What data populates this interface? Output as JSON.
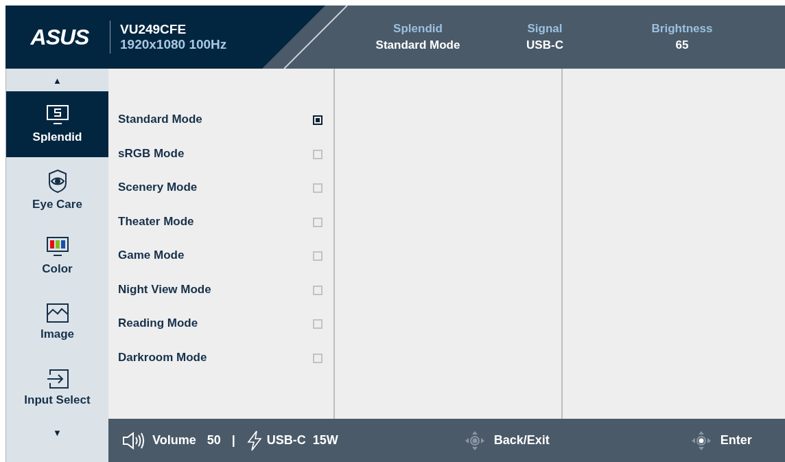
{
  "header": {
    "logo": "ASUS",
    "model": "VU249CFE",
    "resolution": "1920x1080 100Hz",
    "status": [
      {
        "label": "Splendid",
        "value": "Standard Mode"
      },
      {
        "label": "Signal",
        "value": "USB-C"
      },
      {
        "label": "Brightness",
        "value": "65"
      }
    ]
  },
  "sidebar": {
    "up": "▲",
    "down": "▼",
    "items": [
      {
        "kind": "splendid",
        "label": "Splendid",
        "selected": true
      },
      {
        "kind": "eyecare",
        "label": "Eye Care",
        "selected": false
      },
      {
        "kind": "color",
        "label": "Color",
        "selected": false
      },
      {
        "kind": "image",
        "label": "Image",
        "selected": false
      },
      {
        "kind": "input",
        "label": "Input Select",
        "selected": false
      }
    ]
  },
  "options": [
    {
      "label": "Standard Mode",
      "checked": true
    },
    {
      "label": "sRGB Mode",
      "checked": false
    },
    {
      "label": "Scenery Mode",
      "checked": false
    },
    {
      "label": "Theater Mode",
      "checked": false
    },
    {
      "label": "Game Mode",
      "checked": false
    },
    {
      "label": "Night View Mode",
      "checked": false
    },
    {
      "label": "Reading Mode",
      "checked": false
    },
    {
      "label": "Darkroom Mode",
      "checked": false
    }
  ],
  "footer": {
    "volume_label": "Volume",
    "volume_value": "50",
    "separator": "|",
    "power_label": "USB-C",
    "power_value": "15W",
    "keys": [
      {
        "kind": "back",
        "label": "Back/Exit"
      },
      {
        "kind": "enter",
        "label": "Enter"
      }
    ]
  }
}
